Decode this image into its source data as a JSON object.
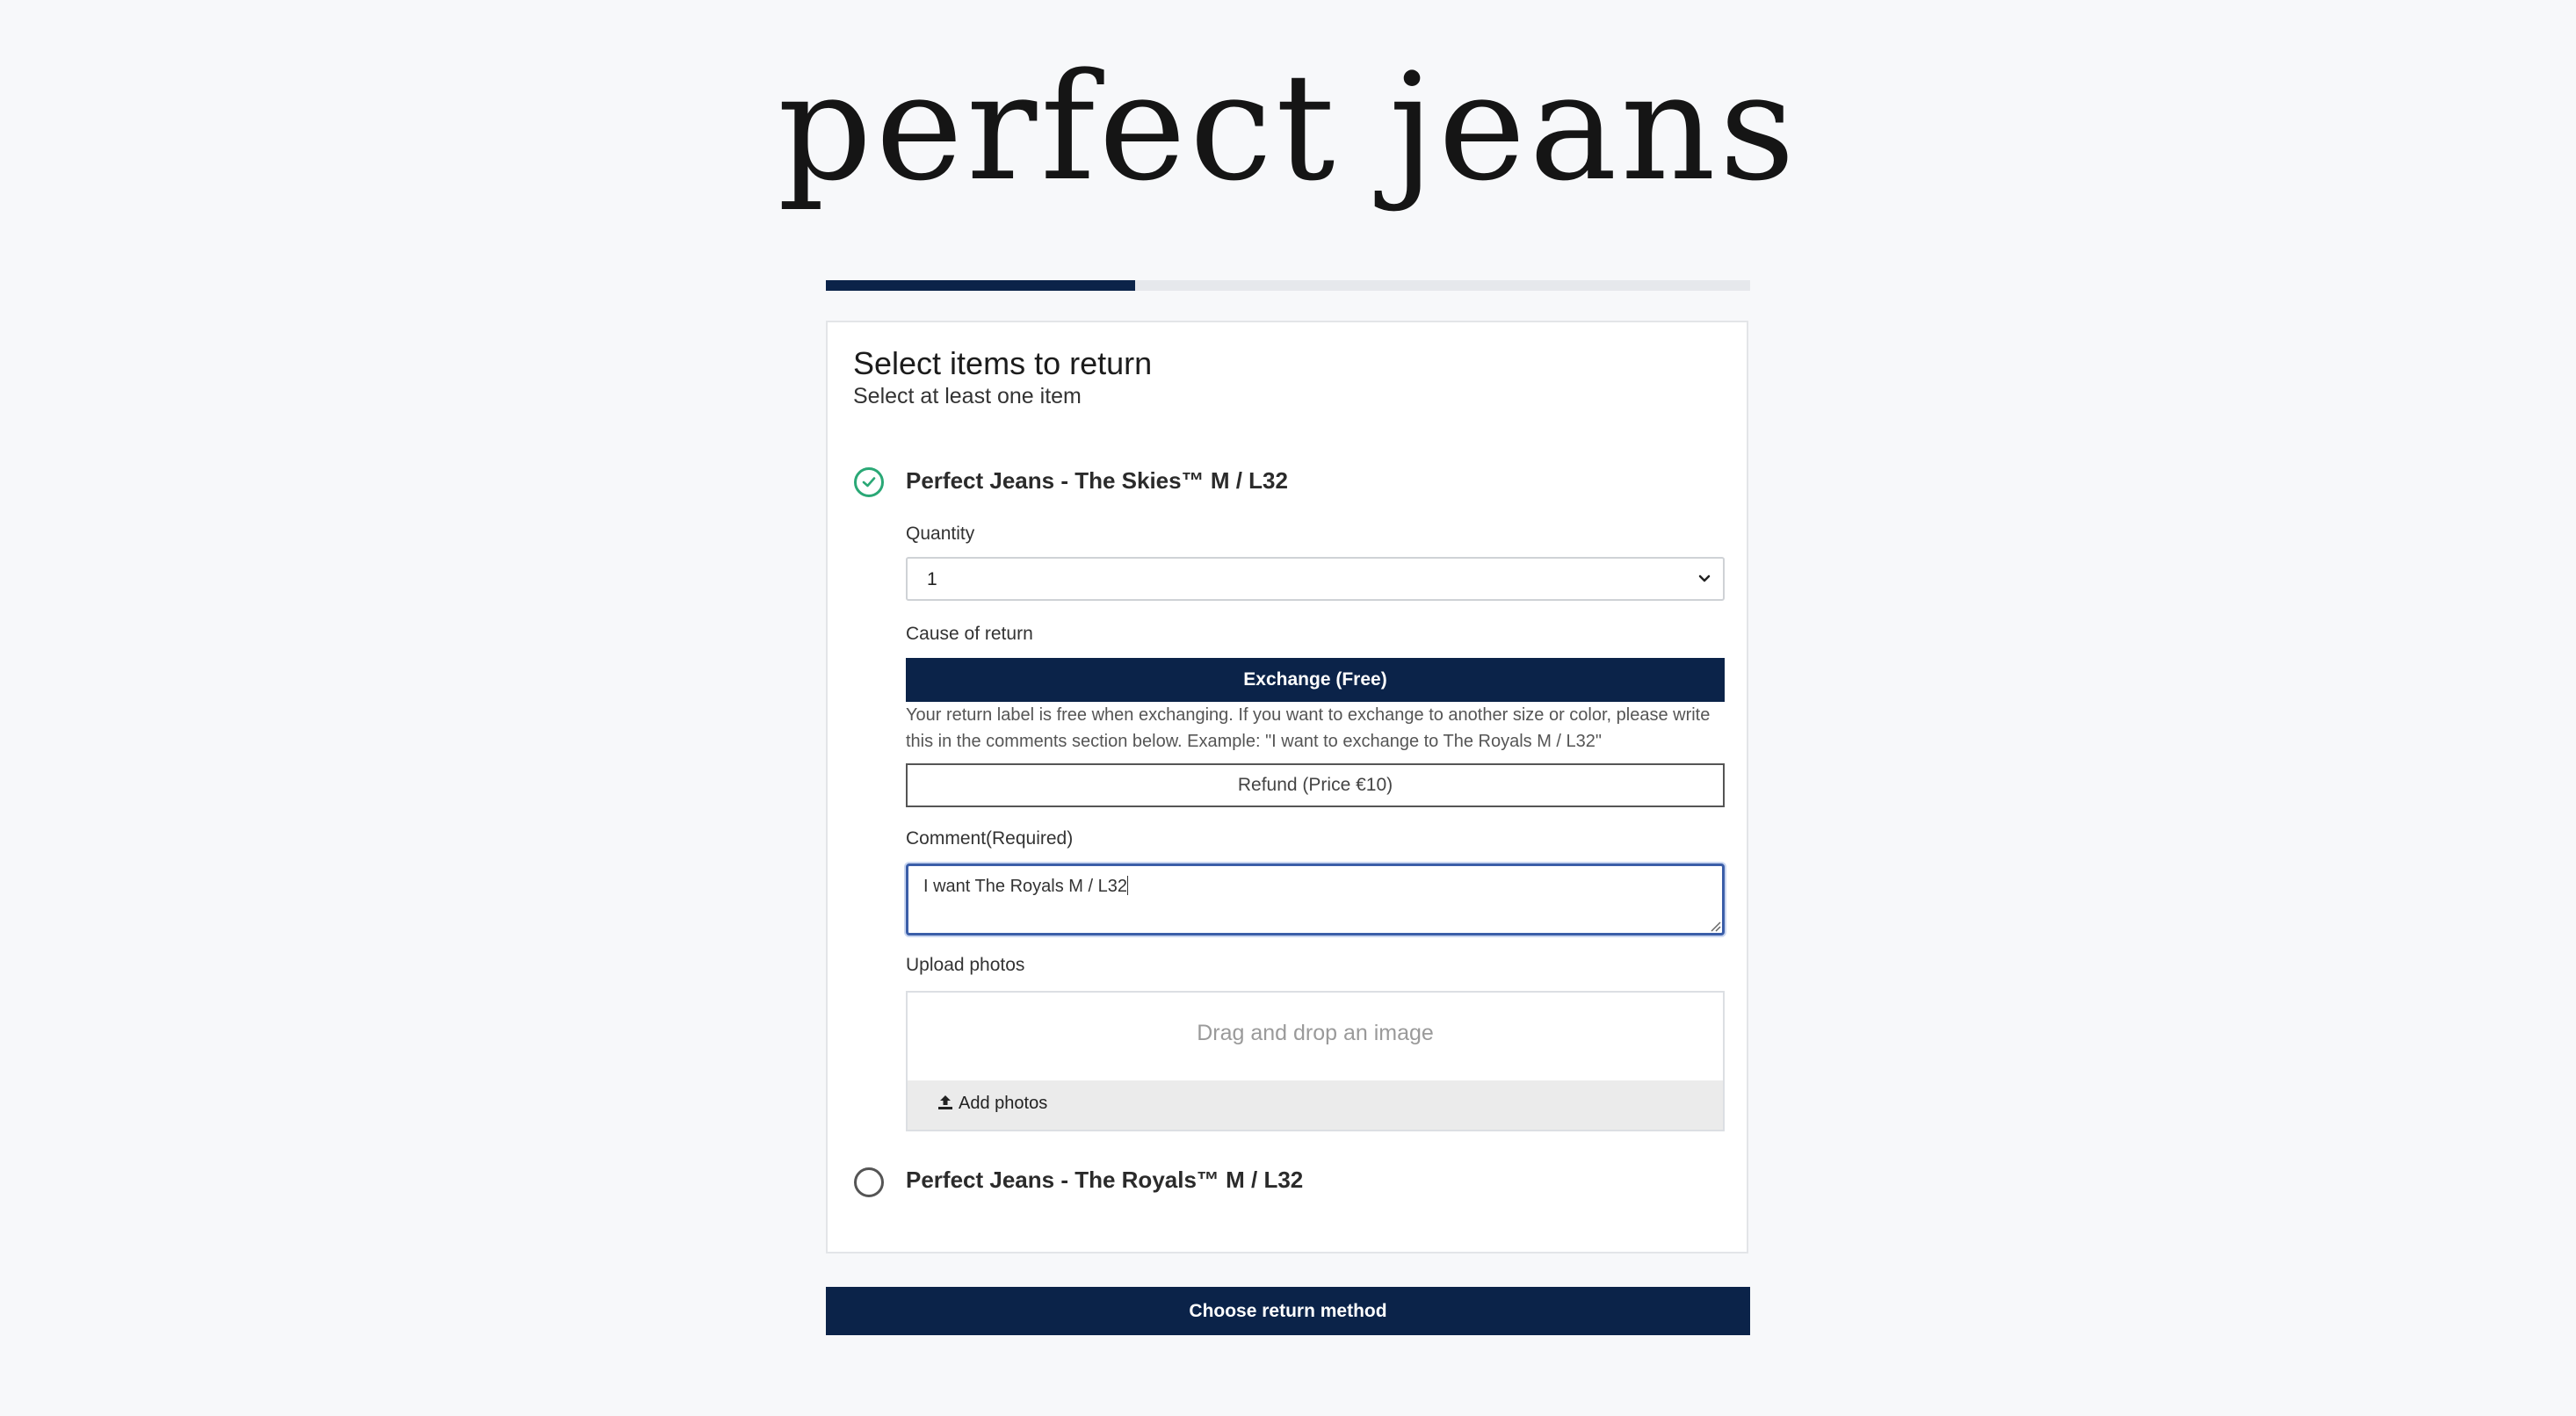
{
  "brand": {
    "logo_text": "perfect jeans",
    "accent_color": "#0b2349",
    "success_color": "#2aa876"
  },
  "progress": {
    "fraction": 0.335
  },
  "form": {
    "title": "Select items to return",
    "subtitle": "Select at least one item",
    "items": [
      {
        "name": "Perfect Jeans - The Skies™ M / L32",
        "selected": true,
        "quantity_label": "Quantity",
        "quantity_value": "1",
        "cause_label": "Cause of return",
        "exchange_label": "Exchange (Free)",
        "exchange_help": "Your return label is free when exchanging. If you want to exchange to another size or color, please write this in the comments section below. Example: \"I want to exchange to The Royals M / L32\"",
        "refund_label": "Refund (Price €10)",
        "comment_label": "Comment(Required)",
        "comment_value": "I want The Royals M / L32",
        "upload_label": "Upload photos",
        "drop_text": "Drag and drop an image",
        "add_photos_label": "Add photos"
      },
      {
        "name": "Perfect Jeans - The Royals™ M / L32",
        "selected": false
      }
    ]
  },
  "cta": {
    "label": "Choose return method"
  },
  "icons": {
    "item1_radio": "check-circle-icon",
    "item2_radio": "empty-circle-icon",
    "select": "chevron-down-icon",
    "upload": "upload-icon"
  }
}
